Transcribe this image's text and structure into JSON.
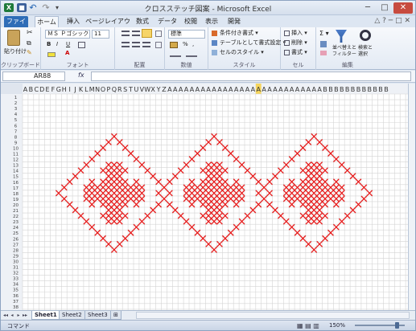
{
  "window": {
    "title": "クロスステッチ図案 - Microsoft Excel",
    "minimize": "─",
    "maximize": "□",
    "close": "✕",
    "app_icon": "X",
    "save_icon": "■",
    "undo_icon": "↶",
    "redo_icon": "↷",
    "qa_more": "▾"
  },
  "tabs": [
    "ファイル",
    "ホーム",
    "挿入",
    "ページレイアウト",
    "数式",
    "データ",
    "校閲",
    "表示",
    "開発"
  ],
  "ribbon_right": "△ ? ─ □ ✕",
  "ribbon": {
    "paste_label": "貼り付け",
    "clipboard_label": "クリップボード",
    "font_name": "ＭＳ Ｐゴシック",
    "font_size": "11",
    "font_label": "フォント",
    "bold": "B",
    "italic": "I",
    "underline": "U",
    "align_label": "配置",
    "number_format": "標準",
    "number_label": "数値",
    "cond_format": "条件付き書式 ▾",
    "table_format": "テーブルとして書式設定 ▾",
    "cell_styles": "セルのスタイル ▾",
    "styles_label": "スタイル",
    "insert": "挿入 ▾",
    "delete": "削除 ▾",
    "format": "書式 ▾",
    "cells_label": "セル",
    "sort_filter": "並べ替えと\nフィルター",
    "find_select": "検索と\n選択",
    "edit_label": "編集",
    "sigma": "Σ ▾",
    "percent": "%",
    "comma": ","
  },
  "formula_bar": {
    "name_box": "AR88",
    "fx": "fx",
    "value": ""
  },
  "grid": {
    "column_headers": "ABCDEFGHIJKLMNOPQRSTUVWXYZAAAAAAAAAAAAAAAAAAAAAAAAAAAABBBBBBBBBBBB",
    "active_column_index": 42,
    "row_count": 38,
    "stitch_color": "#e61c1c",
    "grid_color": "#d4d4d4",
    "header_bg": "#eef1f6",
    "highlight_color": "#f5d55e"
  },
  "sheet_tabs": [
    "Sheet1",
    "Sheet2",
    "Sheet3"
  ],
  "sheet_nav": [
    "◂◂",
    "◂",
    "▸",
    "▸▸"
  ],
  "status": {
    "ready": "コマンド",
    "zoom": "150%",
    "view_icons": "▦ ▤ ▥"
  }
}
